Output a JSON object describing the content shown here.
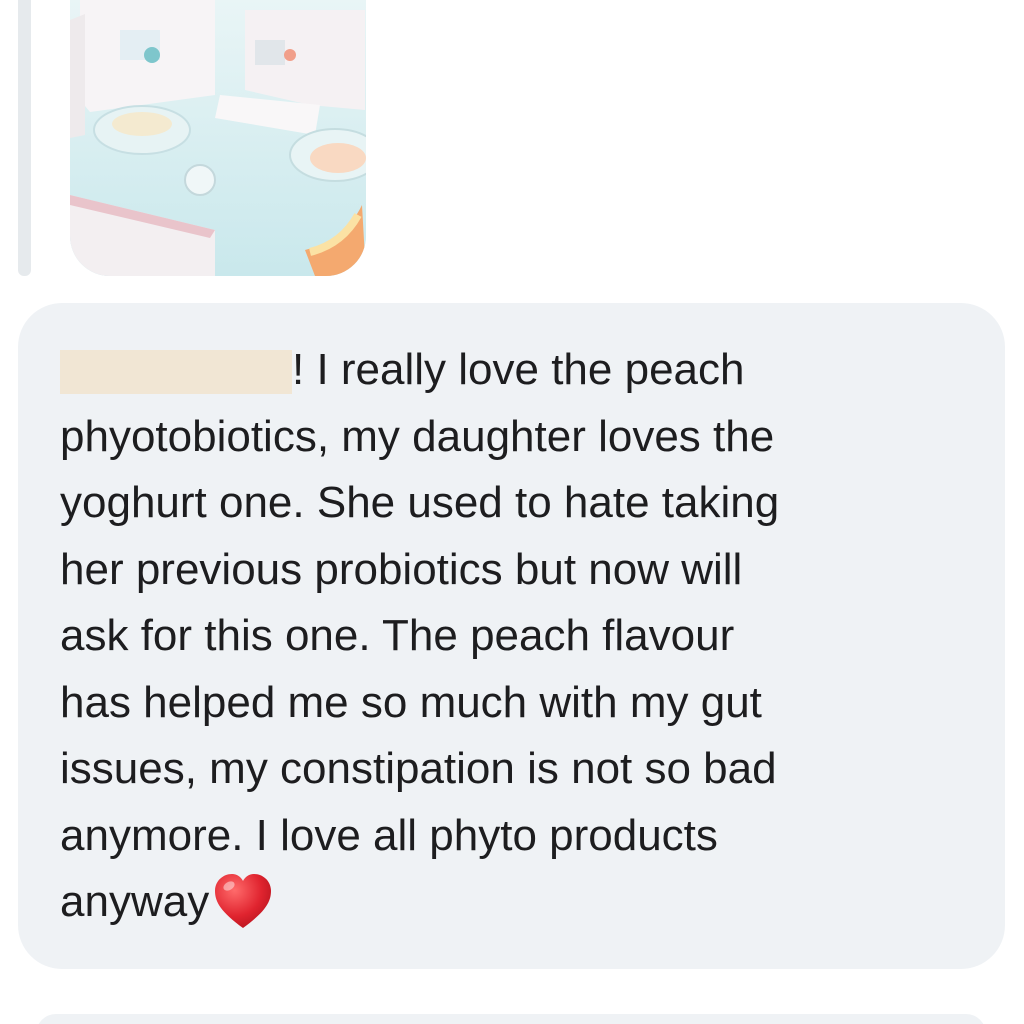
{
  "conversation": {
    "quoted_image_alt": "",
    "message": {
      "redacted_name": "",
      "lines": [
        "! I really love the peach",
        "phyotobiotics, my daughter loves the",
        "yoghurt one. She used to hate taking",
        "her previous probiotics but now will",
        "ask for this one. The peach flavour",
        "has helped me so much with my gut",
        "issues, my constipation is not so bad",
        "anymore. I love all phyto products",
        "anyway"
      ],
      "trailing_emoji": "heart-icon"
    }
  },
  "colors": {
    "bubble_background": "#eff2f5",
    "text": "#1d1d1f",
    "heart": "#e0242f",
    "redaction": "#f1e6d4"
  }
}
